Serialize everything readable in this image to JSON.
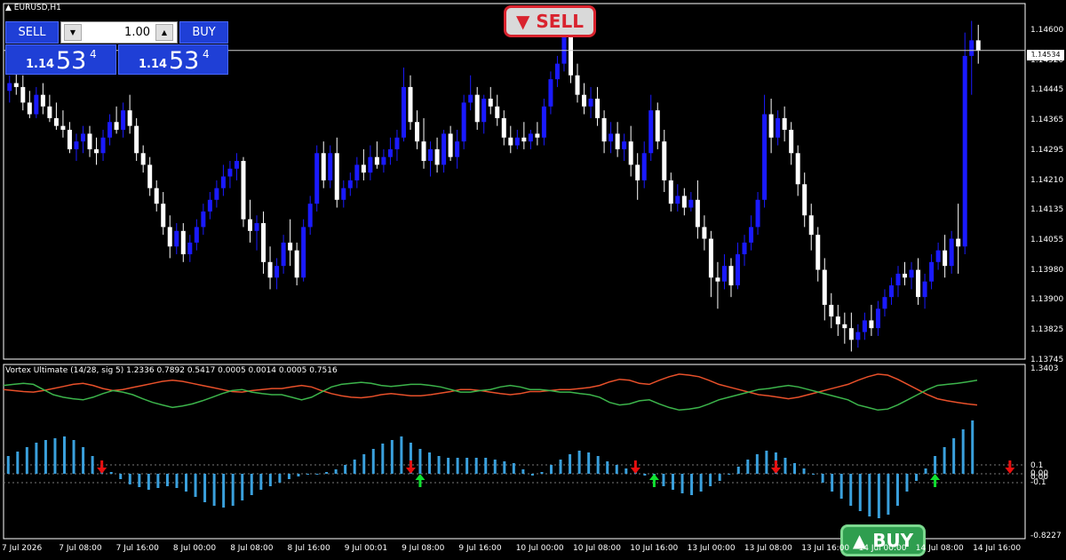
{
  "main_panel": {
    "symbol_label": "EURUSD,H1",
    "price_axis": [
      "1.14600",
      "1.14520",
      "1.14445",
      "1.14365",
      "1.14295",
      "1.14210",
      "1.14135",
      "1.14055",
      "1.13980",
      "1.13900",
      "1.13825",
      "1.13745"
    ],
    "current_price": "1.14534"
  },
  "trade_panel": {
    "sell_label": "SELL",
    "buy_label": "BUY",
    "lot_value": "1.00",
    "sell_price": {
      "small": "1.14",
      "big": "53",
      "sup": "4"
    },
    "buy_price": {
      "small": "1.14",
      "big": "53",
      "sup": "4"
    },
    "lot_down_icon": "down-arrow-icon",
    "lot_up_icon": "up-arrow-icon"
  },
  "signals": {
    "sell_badge": "▼ SELL",
    "buy_badge": "▲ BUY"
  },
  "indicator_panel": {
    "title": "Vortex Ultimate (14/28, sig 5) 1.2336 0.7892 0.5417 0.0005 0.0014 0.0005 0.7516",
    "axis_labels": [
      "1.3403",
      "0.1",
      "0.00",
      "0.00",
      "-0.1",
      "-0.8227"
    ]
  },
  "time_axis": [
    "7 Jul 2026",
    "7 Jul 08:00",
    "7 Jul 16:00",
    "8 Jul 00:00",
    "8 Jul 08:00",
    "8 Jul 16:00",
    "9 Jul 00:01",
    "9 Jul 08:00",
    "9 Jul 16:00",
    "10 Jul 00:00",
    "10 Jul 08:00",
    "10 Jul 16:00",
    "13 Jul 00:00",
    "13 Jul 08:00",
    "13 Jul 16:00",
    "14 Jul 00:00",
    "14 Jul 08:00",
    "14 Jul 16:00"
  ],
  "colors": {
    "bull_candle": "#1a1aff",
    "bear_candle": "#ffffff",
    "vi_plus_line": "#3cb44b",
    "vi_minus_line": "#e8502a",
    "histogram": "#3aa0dc",
    "sell_arrow": "#e81010",
    "buy_arrow": "#10e030",
    "trade_button": "#1f3fd6"
  },
  "chart_data": {
    "type": "candlestick",
    "ylim": [
      1.13745,
      1.1465
    ],
    "candles": [
      [
        1.1443,
        1.1447,
        1.144,
        1.1445
      ],
      [
        1.1445,
        1.1449,
        1.1442,
        1.1444
      ],
      [
        1.1444,
        1.1447,
        1.1438,
        1.144
      ],
      [
        1.144,
        1.1443,
        1.1436,
        1.1437
      ],
      [
        1.1437,
        1.1444,
        1.1436,
        1.1442
      ],
      [
        1.1442,
        1.1445,
        1.1437,
        1.1439
      ],
      [
        1.1439,
        1.1442,
        1.1435,
        1.1436
      ],
      [
        1.1436,
        1.144,
        1.1433,
        1.1434
      ],
      [
        1.1434,
        1.1438,
        1.1431,
        1.1433
      ],
      [
        1.1433,
        1.1435,
        1.1427,
        1.1428
      ],
      [
        1.1428,
        1.1432,
        1.1425,
        1.143
      ],
      [
        1.143,
        1.1434,
        1.1427,
        1.1432
      ],
      [
        1.1432,
        1.1434,
        1.1426,
        1.1428
      ],
      [
        1.1428,
        1.1431,
        1.1424,
        1.1427
      ],
      [
        1.1427,
        1.1433,
        1.1425,
        1.1431
      ],
      [
        1.1431,
        1.1437,
        1.1429,
        1.1435
      ],
      [
        1.1435,
        1.1439,
        1.1432,
        1.1433
      ],
      [
        1.1433,
        1.144,
        1.1431,
        1.1438
      ],
      [
        1.1438,
        1.1442,
        1.1432,
        1.1434
      ],
      [
        1.1434,
        1.1436,
        1.1425,
        1.1427
      ],
      [
        1.1427,
        1.1429,
        1.1422,
        1.1424
      ],
      [
        1.1424,
        1.1426,
        1.1416,
        1.1418
      ],
      [
        1.1418,
        1.142,
        1.1412,
        1.1414
      ],
      [
        1.1414,
        1.1417,
        1.1406,
        1.1408
      ],
      [
        1.1408,
        1.1411,
        1.14,
        1.1403
      ],
      [
        1.1403,
        1.1409,
        1.1401,
        1.1407
      ],
      [
        1.1407,
        1.1409,
        1.1399,
        1.1401
      ],
      [
        1.1401,
        1.1406,
        1.1399,
        1.1404
      ],
      [
        1.1404,
        1.141,
        1.1402,
        1.1408
      ],
      [
        1.1408,
        1.1414,
        1.1406,
        1.1412
      ],
      [
        1.1412,
        1.1417,
        1.141,
        1.1415
      ],
      [
        1.1415,
        1.142,
        1.1413,
        1.1418
      ],
      [
        1.1418,
        1.1424,
        1.1416,
        1.1421
      ],
      [
        1.1421,
        1.1425,
        1.1418,
        1.1423
      ],
      [
        1.1423,
        1.1427,
        1.142,
        1.1425
      ],
      [
        1.1425,
        1.1426,
        1.1408,
        1.141
      ],
      [
        1.141,
        1.1415,
        1.1404,
        1.1407
      ],
      [
        1.1407,
        1.1411,
        1.1402,
        1.1409
      ],
      [
        1.1409,
        1.1412,
        1.1396,
        1.1399
      ],
      [
        1.1399,
        1.1403,
        1.1392,
        1.1395
      ],
      [
        1.1395,
        1.14,
        1.1392,
        1.1398
      ],
      [
        1.1398,
        1.1406,
        1.1396,
        1.1404
      ],
      [
        1.1404,
        1.141,
        1.1398,
        1.1402
      ],
      [
        1.1402,
        1.1404,
        1.1393,
        1.1395
      ],
      [
        1.1395,
        1.141,
        1.1394,
        1.1408
      ],
      [
        1.1408,
        1.1416,
        1.1406,
        1.1414
      ],
      [
        1.1414,
        1.1429,
        1.1412,
        1.1427
      ],
      [
        1.1427,
        1.143,
        1.1418,
        1.142
      ],
      [
        1.142,
        1.1429,
        1.1418,
        1.1427
      ],
      [
        1.1427,
        1.1431,
        1.1413,
        1.1415
      ],
      [
        1.1415,
        1.142,
        1.1413,
        1.1418
      ],
      [
        1.1418,
        1.1422,
        1.1416,
        1.142
      ],
      [
        1.142,
        1.1426,
        1.1418,
        1.1424
      ],
      [
        1.1424,
        1.1428,
        1.142,
        1.1422
      ],
      [
        1.1422,
        1.1429,
        1.142,
        1.1426
      ],
      [
        1.1426,
        1.143,
        1.1423,
        1.1424
      ],
      [
        1.1424,
        1.1428,
        1.1422,
        1.1426
      ],
      [
        1.1426,
        1.1431,
        1.1424,
        1.1428
      ],
      [
        1.1428,
        1.1433,
        1.1425,
        1.1431
      ],
      [
        1.1431,
        1.1449,
        1.143,
        1.1444
      ],
      [
        1.1444,
        1.1447,
        1.1433,
        1.1435
      ],
      [
        1.1435,
        1.1438,
        1.1428,
        1.143
      ],
      [
        1.143,
        1.1436,
        1.1423,
        1.1425
      ],
      [
        1.1425,
        1.143,
        1.1421,
        1.1428
      ],
      [
        1.1428,
        1.1431,
        1.1422,
        1.1424
      ],
      [
        1.1424,
        1.1433,
        1.1422,
        1.1432
      ],
      [
        1.1432,
        1.1434,
        1.1425,
        1.1426
      ],
      [
        1.1426,
        1.1433,
        1.1423,
        1.143
      ],
      [
        1.143,
        1.1442,
        1.1428,
        1.144
      ],
      [
        1.144,
        1.1447,
        1.1438,
        1.1442
      ],
      [
        1.1442,
        1.1444,
        1.1433,
        1.1435
      ],
      [
        1.1435,
        1.1442,
        1.1432,
        1.1441
      ],
      [
        1.1441,
        1.1444,
        1.1437,
        1.1439
      ],
      [
        1.1439,
        1.1442,
        1.1434,
        1.1436
      ],
      [
        1.1436,
        1.1438,
        1.1429,
        1.1431
      ],
      [
        1.1431,
        1.1434,
        1.1427,
        1.1429
      ],
      [
        1.1429,
        1.1433,
        1.1428,
        1.1431
      ],
      [
        1.1431,
        1.1435,
        1.1428,
        1.143
      ],
      [
        1.143,
        1.1433,
        1.1428,
        1.1432
      ],
      [
        1.1432,
        1.1435,
        1.1429,
        1.1431
      ],
      [
        1.1431,
        1.1441,
        1.1429,
        1.1439
      ],
      [
        1.1439,
        1.1448,
        1.1437,
        1.1446
      ],
      [
        1.1446,
        1.1452,
        1.1444,
        1.145
      ],
      [
        1.145,
        1.1462,
        1.1448,
        1.1459
      ],
      [
        1.1459,
        1.146,
        1.1445,
        1.1447
      ],
      [
        1.1447,
        1.145,
        1.144,
        1.1442
      ],
      [
        1.1442,
        1.1445,
        1.1437,
        1.1439
      ],
      [
        1.1439,
        1.1444,
        1.1436,
        1.1441
      ],
      [
        1.1441,
        1.1444,
        1.1434,
        1.1436
      ],
      [
        1.1436,
        1.1438,
        1.1427,
        1.143
      ],
      [
        1.143,
        1.1435,
        1.1427,
        1.1432
      ],
      [
        1.1432,
        1.1435,
        1.1426,
        1.1428
      ],
      [
        1.1428,
        1.1432,
        1.1425,
        1.143
      ],
      [
        1.143,
        1.1434,
        1.1421,
        1.1424
      ],
      [
        1.1424,
        1.1427,
        1.1415,
        1.142
      ],
      [
        1.142,
        1.143,
        1.1418,
        1.1427
      ],
      [
        1.1427,
        1.1442,
        1.1425,
        1.1438
      ],
      [
        1.1438,
        1.144,
        1.1428,
        1.143
      ],
      [
        1.143,
        1.1433,
        1.1417,
        1.142
      ],
      [
        1.142,
        1.1422,
        1.1412,
        1.1414
      ],
      [
        1.1414,
        1.1419,
        1.1412,
        1.1416
      ],
      [
        1.1416,
        1.1418,
        1.1411,
        1.1413
      ],
      [
        1.1413,
        1.1417,
        1.1412,
        1.1415
      ],
      [
        1.1415,
        1.142,
        1.1405,
        1.1408
      ],
      [
        1.1408,
        1.1411,
        1.1402,
        1.1405
      ],
      [
        1.1405,
        1.1407,
        1.139,
        1.1395
      ],
      [
        1.1395,
        1.1399,
        1.1387,
        1.1394
      ],
      [
        1.1394,
        1.1401,
        1.1392,
        1.1398
      ],
      [
        1.1398,
        1.14,
        1.139,
        1.1393
      ],
      [
        1.1393,
        1.1404,
        1.1392,
        1.1401
      ],
      [
        1.1401,
        1.1406,
        1.1398,
        1.1404
      ],
      [
        1.1404,
        1.1411,
        1.1402,
        1.1408
      ],
      [
        1.1408,
        1.1417,
        1.1406,
        1.1415
      ],
      [
        1.1415,
        1.1442,
        1.1413,
        1.1437
      ],
      [
        1.1437,
        1.1441,
        1.1427,
        1.1431
      ],
      [
        1.1431,
        1.1438,
        1.1429,
        1.1436
      ],
      [
        1.1436,
        1.1439,
        1.143,
        1.1433
      ],
      [
        1.1433,
        1.1435,
        1.1424,
        1.1427
      ],
      [
        1.1427,
        1.1429,
        1.1416,
        1.1419
      ],
      [
        1.1419,
        1.1422,
        1.1408,
        1.1411
      ],
      [
        1.1411,
        1.1414,
        1.1402,
        1.1406
      ],
      [
        1.1406,
        1.1408,
        1.1394,
        1.1397
      ],
      [
        1.1397,
        1.14,
        1.1384,
        1.1388
      ],
      [
        1.1388,
        1.1391,
        1.1382,
        1.1385
      ],
      [
        1.1385,
        1.1388,
        1.138,
        1.1383
      ],
      [
        1.1383,
        1.1386,
        1.1378,
        1.1382
      ],
      [
        1.1382,
        1.1386,
        1.1376,
        1.1379
      ],
      [
        1.1379,
        1.1383,
        1.1377,
        1.1381
      ],
      [
        1.1381,
        1.1386,
        1.1379,
        1.1384
      ],
      [
        1.1384,
        1.1388,
        1.138,
        1.1382
      ],
      [
        1.1382,
        1.1389,
        1.138,
        1.1387
      ],
      [
        1.1387,
        1.1392,
        1.1385,
        1.139
      ],
      [
        1.139,
        1.1395,
        1.1388,
        1.1393
      ],
      [
        1.1393,
        1.1398,
        1.139,
        1.1396
      ],
      [
        1.1396,
        1.1399,
        1.1393,
        1.1395
      ],
      [
        1.1395,
        1.1399,
        1.1392,
        1.1397
      ],
      [
        1.1397,
        1.14,
        1.1388,
        1.139
      ],
      [
        1.139,
        1.1396,
        1.1387,
        1.1394
      ],
      [
        1.1394,
        1.1401,
        1.1392,
        1.1399
      ],
      [
        1.1399,
        1.1404,
        1.1397,
        1.1402
      ],
      [
        1.1402,
        1.1406,
        1.1395,
        1.1398
      ],
      [
        1.1398,
        1.1407,
        1.1396,
        1.1405
      ],
      [
        1.1405,
        1.1414,
        1.1396,
        1.1403
      ],
      [
        1.1403,
        1.1458,
        1.1401,
        1.1452
      ],
      [
        1.1452,
        1.1461,
        1.1442,
        1.1456
      ],
      [
        1.1456,
        1.146,
        1.145,
        1.14534
      ]
    ],
    "vi_plus": [
      0.18,
      0.2,
      0.22,
      0.2,
      0.1,
      0.0,
      -0.05,
      -0.08,
      -0.1,
      -0.05,
      0.02,
      0.08,
      0.05,
      0.0,
      -0.08,
      -0.15,
      -0.2,
      -0.25,
      -0.22,
      -0.18,
      -0.12,
      -0.05,
      0.02,
      0.08,
      0.1,
      0.05,
      0.02,
      0.0,
      0.0,
      -0.05,
      -0.1,
      -0.05,
      0.05,
      0.15,
      0.2,
      0.22,
      0.24,
      0.22,
      0.18,
      0.16,
      0.18,
      0.2,
      0.2,
      0.18,
      0.15,
      0.1,
      0.05,
      0.05,
      0.08,
      0.1,
      0.15,
      0.18,
      0.15,
      0.1,
      0.1,
      0.08,
      0.05,
      0.05,
      0.02,
      0.0,
      -0.05,
      -0.15,
      -0.2,
      -0.18,
      -0.12,
      -0.1,
      -0.18,
      -0.25,
      -0.3,
      -0.28,
      -0.25,
      -0.18,
      -0.1,
      -0.05,
      0.0,
      0.05,
      0.1,
      0.12,
      0.15,
      0.18,
      0.15,
      0.1,
      0.05,
      0.0,
      -0.05,
      -0.1,
      -0.2,
      -0.25,
      -0.3,
      -0.28,
      -0.2,
      -0.1,
      0.0,
      0.1,
      0.18,
      0.2,
      0.22,
      0.25,
      0.28
    ],
    "vi_minus": [
      0.1,
      0.08,
      0.06,
      0.05,
      0.08,
      0.12,
      0.16,
      0.2,
      0.22,
      0.18,
      0.12,
      0.08,
      0.1,
      0.14,
      0.18,
      0.22,
      0.26,
      0.28,
      0.26,
      0.22,
      0.18,
      0.14,
      0.1,
      0.06,
      0.05,
      0.08,
      0.1,
      0.12,
      0.12,
      0.15,
      0.18,
      0.15,
      0.08,
      0.02,
      -0.02,
      -0.05,
      -0.06,
      -0.04,
      0.0,
      0.02,
      0.0,
      -0.02,
      -0.02,
      0.0,
      0.03,
      0.06,
      0.1,
      0.1,
      0.08,
      0.05,
      0.02,
      0.0,
      0.02,
      0.06,
      0.06,
      0.08,
      0.1,
      0.1,
      0.12,
      0.14,
      0.18,
      0.25,
      0.3,
      0.28,
      0.22,
      0.2,
      0.28,
      0.35,
      0.4,
      0.38,
      0.35,
      0.28,
      0.2,
      0.15,
      0.1,
      0.05,
      0.0,
      -0.02,
      -0.05,
      -0.08,
      -0.05,
      0.0,
      0.05,
      0.1,
      0.15,
      0.2,
      0.28,
      0.35,
      0.4,
      0.38,
      0.3,
      0.2,
      0.1,
      0.0,
      -0.08,
      -0.12,
      -0.15,
      -0.18,
      -0.2
    ],
    "histogram": [
      0.2,
      0.25,
      0.3,
      0.35,
      0.38,
      0.4,
      0.42,
      0.38,
      0.3,
      0.2,
      0.1,
      0.02,
      -0.06,
      -0.12,
      -0.15,
      -0.18,
      -0.16,
      -0.14,
      -0.16,
      -0.2,
      -0.26,
      -0.32,
      -0.36,
      -0.38,
      -0.36,
      -0.3,
      -0.24,
      -0.18,
      -0.14,
      -0.1,
      -0.06,
      -0.03,
      -0.01,
      0.0,
      0.02,
      0.05,
      0.1,
      0.16,
      0.22,
      0.28,
      0.34,
      0.38,
      0.42,
      0.35,
      0.28,
      0.24,
      0.2,
      0.18,
      0.18,
      0.18,
      0.18,
      0.18,
      0.16,
      0.14,
      0.12,
      0.05,
      -0.02,
      0.02,
      0.1,
      0.16,
      0.22,
      0.26,
      0.24,
      0.2,
      0.14,
      0.1,
      0.06,
      0.02,
      -0.02,
      -0.08,
      -0.14,
      -0.18,
      -0.22,
      -0.24,
      -0.2,
      -0.14,
      -0.08,
      0.0,
      0.08,
      0.16,
      0.22,
      0.26,
      0.24,
      0.18,
      0.12,
      0.06,
      0.0,
      -0.1,
      -0.2,
      -0.28,
      -0.36,
      -0.42,
      -0.48,
      -0.5,
      -0.46,
      -0.36,
      -0.2,
      -0.08,
      0.06,
      0.2,
      0.3,
      0.4,
      0.5,
      0.6
    ],
    "sell_arrow_bars": [
      10,
      43,
      67,
      82,
      107
    ],
    "buy_arrow_bars": [
      44,
      69,
      99,
      121
    ],
    "histogram_ylim": [
      -0.8227,
      1.3403
    ]
  }
}
